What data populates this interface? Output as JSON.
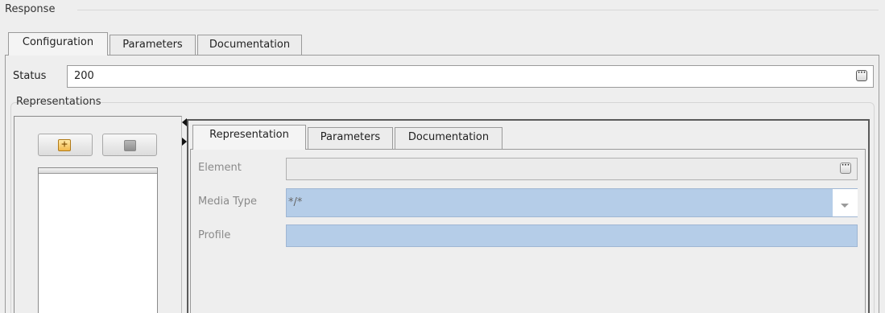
{
  "section": {
    "title": "Response"
  },
  "top_tabs": [
    {
      "label": "Configuration",
      "active": true
    },
    {
      "label": "Parameters",
      "active": false
    },
    {
      "label": "Documentation",
      "active": false
    }
  ],
  "status": {
    "label": "Status",
    "value": "200",
    "button_icon": "ellipsis-icon"
  },
  "representations": {
    "title": "Representations",
    "toolbar": {
      "add_icon": "plus-icon",
      "remove_icon": "minus-icon"
    },
    "tabs": [
      {
        "label": "Representation",
        "active": true
      },
      {
        "label": "Parameters",
        "active": false
      },
      {
        "label": "Documentation",
        "active": false
      }
    ],
    "fields": {
      "element": {
        "label": "Element",
        "value": "",
        "button_icon": "ellipsis-icon"
      },
      "media_type": {
        "label": "Media Type",
        "value": "*/*",
        "icon": "chevron-down-icon"
      },
      "profile": {
        "label": "Profile",
        "value": ""
      }
    }
  },
  "colors": {
    "background": "#eeeeee",
    "selected_field": "#b5cde8",
    "border": "#9a9a9a"
  }
}
